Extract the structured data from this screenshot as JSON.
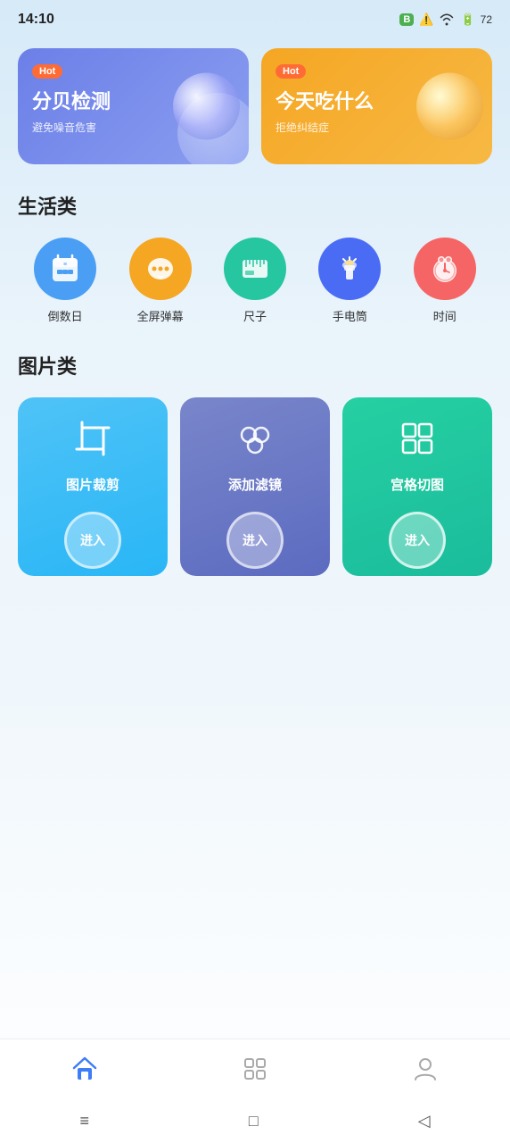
{
  "statusBar": {
    "time": "14:10",
    "batteryLevel": "72"
  },
  "banners": [
    {
      "id": "banner-1",
      "hotLabel": "Hot",
      "title": "分贝检测",
      "subtitle": "避免噪音危害",
      "colorClass": "banner-card-left"
    },
    {
      "id": "banner-2",
      "hotLabel": "Hot",
      "title": "今天吃什么",
      "subtitle": "拒绝纠结症",
      "colorClass": "banner-card-right"
    }
  ],
  "lifeSection": {
    "title": "生活类",
    "tools": [
      {
        "id": "countdown",
        "label": "倒数日",
        "bgClass": "bg-blue",
        "emoji": "📅"
      },
      {
        "id": "fullscreen",
        "label": "全屏弹幕",
        "bgClass": "bg-orange",
        "emoji": "💬"
      },
      {
        "id": "ruler",
        "label": "尺子",
        "bgClass": "bg-teal",
        "emoji": "📐"
      },
      {
        "id": "torch",
        "label": "手电筒",
        "bgClass": "bg-navy",
        "emoji": "🔦"
      },
      {
        "id": "time",
        "label": "时间",
        "bgClass": "bg-red-light",
        "emoji": "⏰"
      }
    ]
  },
  "imageSection": {
    "title": "图片类",
    "tools": [
      {
        "id": "crop",
        "label": "图片裁剪",
        "enterLabel": "进入",
        "colorClass": "image-tool-card-blue",
        "iconSymbol": "⊡"
      },
      {
        "id": "filter",
        "label": "添加滤镜",
        "enterLabel": "进入",
        "colorClass": "image-tool-card-purple",
        "iconSymbol": "❋"
      },
      {
        "id": "grid",
        "label": "宫格切图",
        "enterLabel": "进入",
        "colorClass": "image-tool-card-teal",
        "iconSymbol": "⊞"
      }
    ]
  },
  "bottomNav": {
    "items": [
      {
        "id": "home",
        "label": "首页",
        "active": true,
        "emoji": "🏠"
      },
      {
        "id": "apps",
        "label": "应用",
        "active": false,
        "emoji": "⊞"
      },
      {
        "id": "profile",
        "label": "我的",
        "active": false,
        "emoji": "👤"
      }
    ]
  },
  "sysNav": {
    "menu": "≡",
    "home": "□",
    "back": "◁"
  }
}
